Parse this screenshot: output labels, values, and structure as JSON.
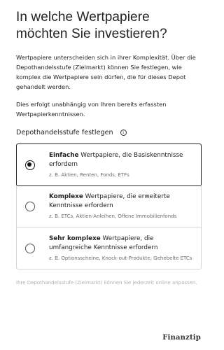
{
  "heading": "In welche Wertpapiere möchten Sie investieren?",
  "intro": "Wertpapiere unterscheiden sich in ihrer Komplexität. Über die Depothandelsstufe (Zielmarkt) können Sie festlegen, wie komplex die Wertpapiere sein dürfen, die für dieses Depot gehandelt werden.",
  "intro2": "Dies erfolgt unabhängig von Ihren bereits erfassten Wertpapierkenntnissen.",
  "section": {
    "title": "Depothandelsstufe festlegen",
    "info_icon": "info-icon"
  },
  "options": [
    {
      "bold": "Einfache",
      "rest": " Wertpapiere, die Basiskenntnisse erfordern",
      "sub": "z. B. Aktien, Renten, Fonds, ETFs",
      "selected": true
    },
    {
      "bold": "Komplexe",
      "rest": " Wertpapiere, die erweiterte Kenntnisse erfordern",
      "sub": "z. B. ETCs, Aktien-Anleihen, Offene Immobilienfonds",
      "selected": false
    },
    {
      "bold": "Sehr komplexe",
      "rest": " Wertpapiere, die umfangreiche Kenntnisse erfordern",
      "sub": "z. B. Optionsscheine, Knock-out-Produkte, Gehebelte ETCs",
      "selected": false
    }
  ],
  "footnote": "Ihre Depothandelsstufe (Zielmarkt) können Sie jederzeit online anpassen.",
  "logo": "Finanztip"
}
